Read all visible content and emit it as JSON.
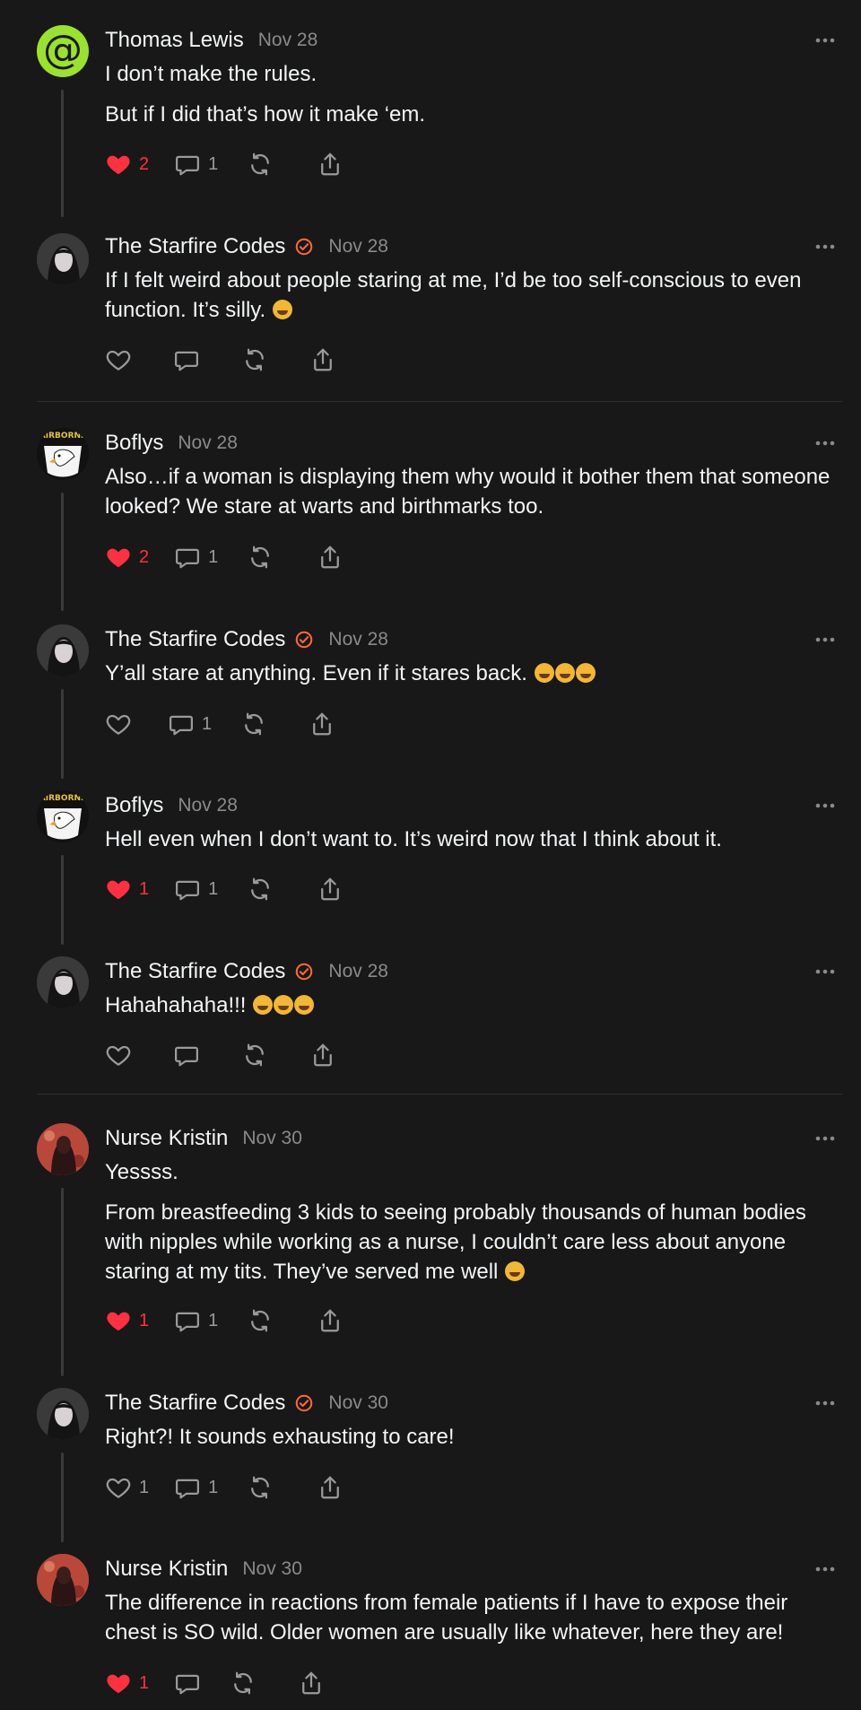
{
  "posts": [
    {
      "author": "Thomas Lewis",
      "date": "Nov 28",
      "verified": false,
      "avatar": "at-sign-avatar",
      "paragraphs": [
        "I don’t make the rules.",
        "But if I did that’s how it make ‘em."
      ],
      "liked": true,
      "likes": "2",
      "replies": "1"
    },
    {
      "author": "The Starfire Codes",
      "date": "Nov 28",
      "verified": true,
      "avatar": "portrait-avatar",
      "paragraphs": [
        "If I felt weird about people staring at me, I’d be too self-conscious to even function. It’s silly."
      ],
      "emoji": [
        "laughing-emoji"
      ],
      "liked": false,
      "likes": "",
      "replies": ""
    },
    {
      "author": "Boflys",
      "date": "Nov 28",
      "verified": false,
      "avatar": "airborne-eagle-avatar",
      "avatar_text": "AIRBORNE",
      "paragraphs": [
        "Also…if a woman is displaying them why would it bother them that someone looked? We stare at warts and birthmarks too."
      ],
      "liked": true,
      "likes": "2",
      "replies": "1"
    },
    {
      "author": "The Starfire Codes",
      "date": "Nov 28",
      "verified": true,
      "avatar": "portrait-avatar",
      "paragraphs": [
        "Y’all stare at anything. Even if it stares back."
      ],
      "emoji": [
        "laughing-emoji",
        "laughing-emoji",
        "laughing-emoji"
      ],
      "liked": false,
      "likes": "",
      "replies": "1"
    },
    {
      "author": "Boflys",
      "date": "Nov 28",
      "verified": false,
      "avatar": "airborne-eagle-avatar",
      "avatar_text": "AIRBORNE",
      "paragraphs": [
        "Hell even when I don’t want to. It’s weird now that I think about it."
      ],
      "liked": true,
      "likes": "1",
      "replies": "1"
    },
    {
      "author": "The Starfire Codes",
      "date": "Nov 28",
      "verified": true,
      "avatar": "portrait-avatar",
      "paragraphs": [
        "Hahahahaha!!!"
      ],
      "emoji": [
        "laughing-emoji",
        "laughing-emoji",
        "laughing-emoji"
      ],
      "liked": false,
      "likes": "",
      "replies": ""
    },
    {
      "author": "Nurse Kristin",
      "date": "Nov 30",
      "verified": false,
      "avatar": "nurse-avatar",
      "paragraphs": [
        "Yessss.",
        "From breastfeeding 3 kids to seeing probably thousands of human bodies with nipples while working as a nurse, I couldn’t care less about anyone staring at my tits. They’ve served me well"
      ],
      "emoji": [
        "winking-emoji"
      ],
      "liked": true,
      "likes": "1",
      "replies": "1"
    },
    {
      "author": "The Starfire Codes",
      "date": "Nov 30",
      "verified": true,
      "avatar": "portrait-avatar",
      "paragraphs": [
        "Right?! It sounds exhausting to care!"
      ],
      "liked": false,
      "likes": "1",
      "replies": "1"
    },
    {
      "author": "Nurse Kristin",
      "date": "Nov 30",
      "verified": false,
      "avatar": "nurse-avatar",
      "paragraphs": [
        "The difference in reactions from female patients if I have to expose their chest is SO wild. Older women are usually like whatever, here they are!"
      ],
      "liked": true,
      "likes": "1",
      "replies": ""
    }
  ],
  "colors": {
    "background": "#181818",
    "text": "#f3f5f7",
    "muted": "#8a8a8a",
    "like": "#ff3040",
    "verified": "#ff6b35",
    "avatar_green": "#9be22d"
  }
}
